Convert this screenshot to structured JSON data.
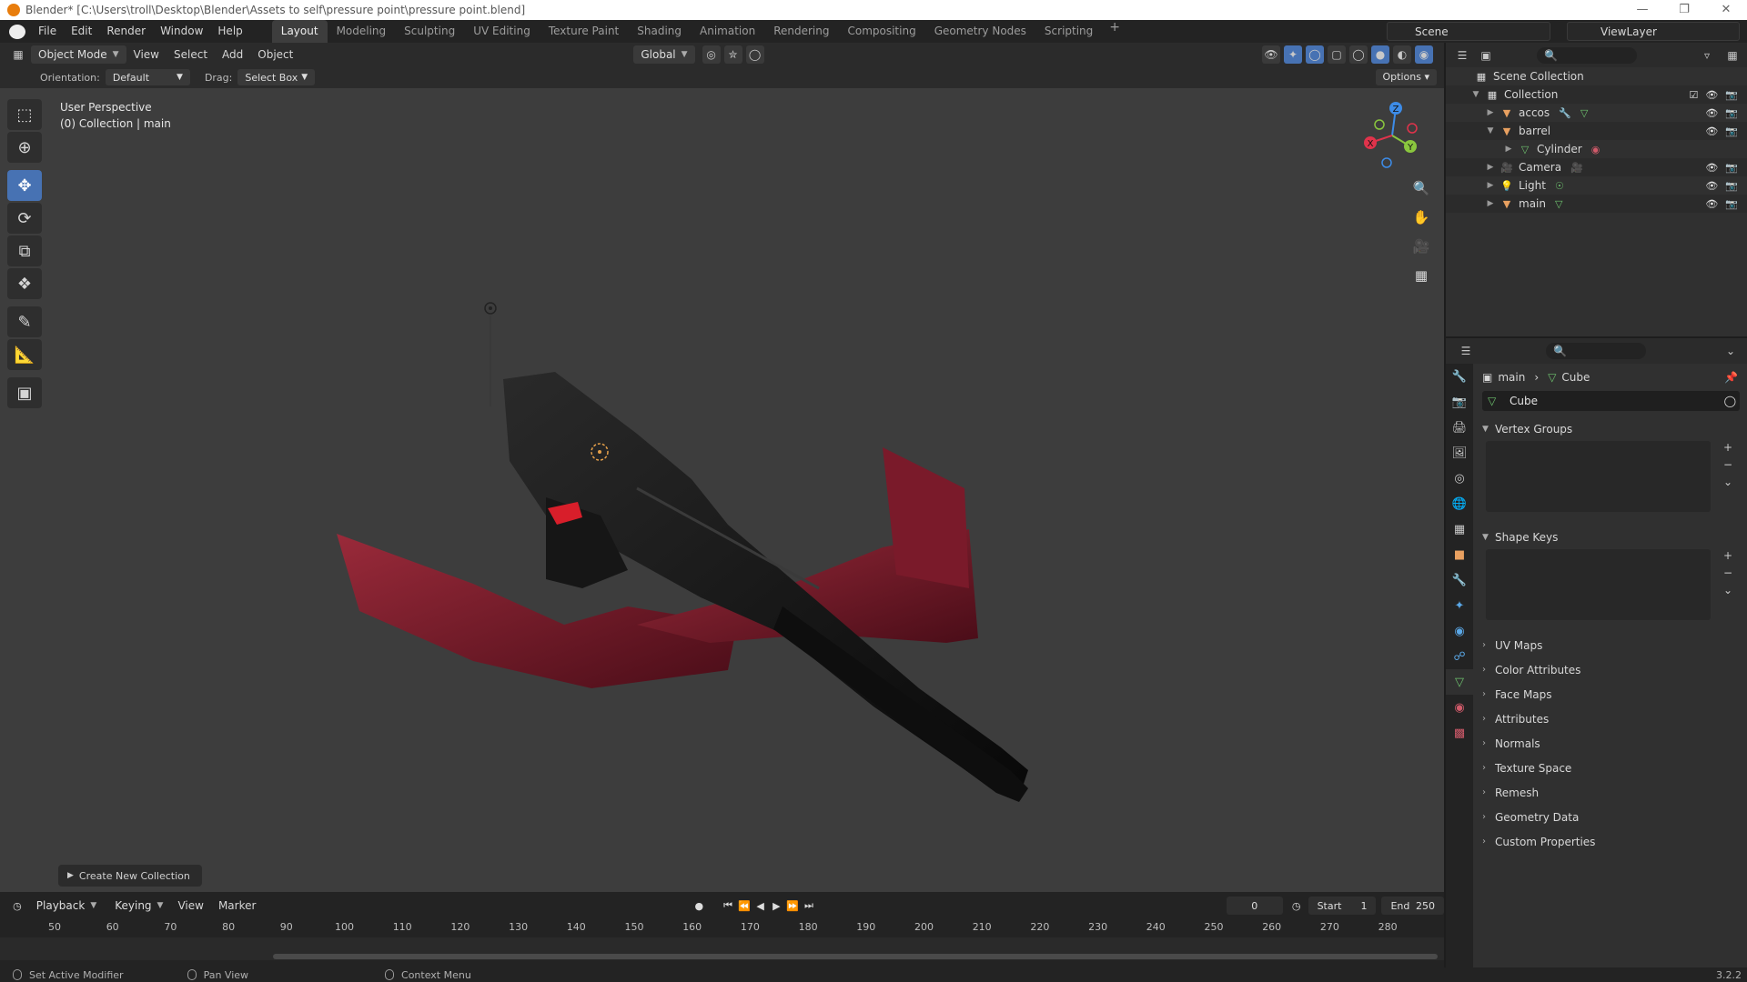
{
  "window": {
    "title": "Blender* [C:\\Users\\troll\\Desktop\\Blender\\Assets to self\\pressure point\\pressure point.blend]",
    "controls": [
      "—",
      "❐",
      "✕"
    ]
  },
  "menubar": {
    "items": [
      "File",
      "Edit",
      "Render",
      "Window",
      "Help"
    ],
    "workspaces": [
      "Layout",
      "Modeling",
      "Sculpting",
      "UV Editing",
      "Texture Paint",
      "Shading",
      "Animation",
      "Rendering",
      "Compositing",
      "Geometry Nodes",
      "Scripting"
    ],
    "active_workspace": "Layout",
    "add_label": "+",
    "scene": "Scene",
    "view_layer": "ViewLayer"
  },
  "viewport": {
    "mode": "Object Mode",
    "menus": [
      "View",
      "Select",
      "Add",
      "Object"
    ],
    "transform_orientation": "Global",
    "orientation_label": "Orientation:",
    "orientation_value": "Default",
    "drag_label": "Drag:",
    "drag_value": "Select Box",
    "options_label": "Options",
    "overlay_line1": "User Perspective",
    "overlay_line2": "(0) Collection | main",
    "gizmo_axes": [
      "X",
      "Y",
      "Z"
    ],
    "last_op_panel": "Create New Collection"
  },
  "timeline": {
    "menus": [
      "Playback",
      "Keying",
      "View",
      "Marker"
    ],
    "current_frame": "0",
    "start_label": "Start",
    "start": "1",
    "end_label": "End",
    "end": "250",
    "ruler": [
      "50",
      "60",
      "70",
      "80",
      "90",
      "100",
      "110",
      "120",
      "130",
      "140",
      "150",
      "160",
      "170",
      "180",
      "190",
      "200",
      "210",
      "220",
      "230",
      "240",
      "250",
      "260",
      "270",
      "280"
    ]
  },
  "statusbar": {
    "items": [
      "Set Active Modifier",
      "Pan View",
      "Context Menu"
    ],
    "version": "3.2.2"
  },
  "outliner": {
    "root": "Scene Collection",
    "collection": "Collection",
    "rows": [
      {
        "name": "accos",
        "color": "#e8a060"
      },
      {
        "name": "barrel",
        "color": "#e8a060"
      },
      {
        "name": "Cylinder",
        "color": "#6ec26e"
      },
      {
        "name": "Camera",
        "color": "#e8a060"
      },
      {
        "name": "Light",
        "color": "#e8a060"
      },
      {
        "name": "main",
        "color": "#e8a060"
      }
    ]
  },
  "properties": {
    "breadcrumb_object": "main",
    "breadcrumb_data": "Cube",
    "mesh_name": "Cube",
    "vertex_groups": "Vertex Groups",
    "shape_keys": "Shape Keys",
    "collapsed_panels": [
      "UV Maps",
      "Color Attributes",
      "Face Maps",
      "Attributes",
      "Normals",
      "Texture Space",
      "Remesh",
      "Geometry Data",
      "Custom Properties"
    ]
  },
  "colors": {
    "accent": "#4772b3",
    "viewport_bg": "#3d3d3d",
    "x_axis": "#e0334b",
    "y_axis": "#8ac63e",
    "z_axis": "#3d8ce8"
  }
}
